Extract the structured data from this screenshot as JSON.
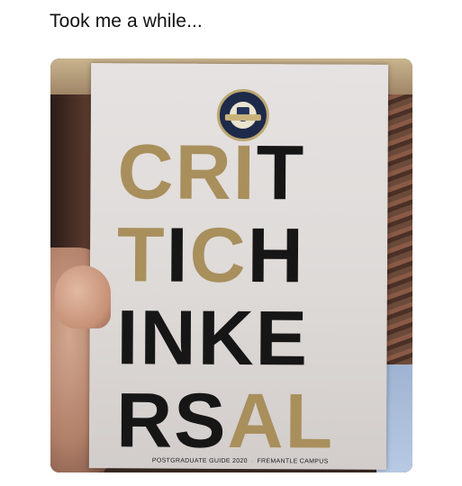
{
  "post": {
    "caption": "Took me a while..."
  },
  "booklet": {
    "rows": [
      [
        {
          "text": "C",
          "color": "gold"
        },
        {
          "text": "R",
          "color": "gold"
        },
        {
          "text": "I",
          "color": "gold"
        },
        {
          "text": "T",
          "color": "black"
        }
      ],
      [
        {
          "text": "T",
          "color": "gold"
        },
        {
          "text": "I",
          "color": "black"
        },
        {
          "text": "C",
          "color": "gold"
        },
        {
          "text": "H",
          "color": "black"
        }
      ],
      [
        {
          "text": "I",
          "color": "black"
        },
        {
          "text": "N",
          "color": "black"
        },
        {
          "text": "K",
          "color": "black"
        },
        {
          "text": "E",
          "color": "black"
        }
      ],
      [
        {
          "text": "R",
          "color": "black"
        },
        {
          "text": "S",
          "color": "black"
        },
        {
          "text": "A",
          "color": "gold"
        },
        {
          "text": "L",
          "color": "gold"
        }
      ]
    ],
    "footer_left": "POSTGRADUATE GUIDE 2020",
    "footer_sep": "·",
    "footer_right": "FREMANTLE CAMPUS",
    "crest_icon": "university-crest-icon",
    "colors": {
      "gold": "#a88f5c",
      "black": "#161616",
      "paper": "#e2dedc"
    }
  }
}
